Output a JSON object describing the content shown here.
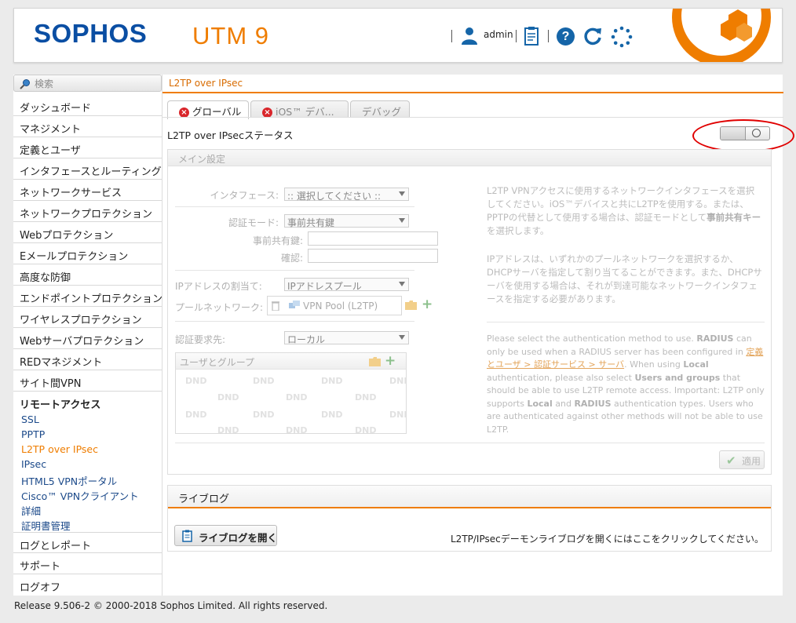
{
  "header": {
    "logo": "SOPHOS",
    "product": "UTM 9",
    "user": "admin",
    "brand_color": "#ef7d00",
    "logo_color": "#0a4ea3"
  },
  "sidebar": {
    "search_placeholder": "検索",
    "items": [
      "ダッシュボード",
      "マネジメント",
      "定義とユーザ",
      "インタフェースとルーティング",
      "ネットワークサービス",
      "ネットワークプロテクション",
      "Webプロテクション",
      "Eメールプロテクション",
      "高度な防御",
      "エンドポイントプロテクション",
      "ワイヤレスプロテクション",
      "Webサーバプロテクション",
      "REDマネジメント",
      "サイト間VPN",
      "リモートアクセス"
    ],
    "subitems": [
      "SSL",
      "PPTP",
      "L2TP over IPsec",
      "IPsec",
      "HTML5 VPNポータル",
      "Cisco™ VPNクライアント",
      "詳細",
      "証明書管理"
    ],
    "bottom_items": [
      "ログとレポート",
      "サポート",
      "ログオフ"
    ]
  },
  "main": {
    "breadcrumb": "L2TP over IPsec",
    "tabs": [
      "グローバル",
      "iOS™ デバ...",
      "デバッグ"
    ],
    "status_label": "L2TP over IPsecステータス",
    "status_enabled": false,
    "panel": {
      "title": "メイン設定",
      "interface_label": "インタフェース:",
      "interface_value": ":: 選択してください ::",
      "auth_mode_label": "認証モード:",
      "auth_mode_value": "事前共有鍵",
      "psk_label": "事前共有鍵:",
      "confirm_label": "確認:",
      "ip_assign_label": "IPアドレスの割当て:",
      "ip_assign_value": "IPアドレスプール",
      "pool_label": "プールネットワーク:",
      "pool_value": "VPN Pool (L2TP)",
      "auth_via_label": "認証要求先:",
      "auth_via_value": "ローカル",
      "users_title": "ユーザとグループ",
      "dnd": "DND",
      "help1": "L2TP VPNアクセスに使用するネットワークインタフェースを選択してください。iOS™デバイスと共にL2TPを使用する。または、PPTPの代替として使用する場合は、認証モードとして",
      "help1_bold": "事前共有キー",
      "help1_end": "を選択します。",
      "help2": "IPアドレスは、いずれかのプールネットワークを選択するか、DHCPサーバを指定して割り当てることができます。また、DHCPサーバを使用する場合は、それが到達可能なネットワークインタフェースを指定する必要があります。",
      "help3_a": "Please select the authentication method to use.",
      "help3_b": "RADIUS",
      "help3_c": "can only be used when a RADIUS server has been configured in",
      "help3_link": "定義とユーザ > 認証サービス > サーバ",
      "help3_d": ". When using",
      "help3_e": "Local",
      "help3_f": "authentication, please also select",
      "help3_g": "Users and groups",
      "help3_h": "that should be able to use L2TP remote access. Important: L2TP only supports",
      "help3_i": "Local",
      "help3_j": "and",
      "help3_k": "RADIUS",
      "help3_l": "authentication types. Users who are authenticated against other methods will not be able to use L2TP.",
      "apply": "適用"
    },
    "live": {
      "title": "ライブログ",
      "button": "ライブログを開く",
      "description": "L2TP/IPsecデーモンライブログを開くにはここをクリックしてください。"
    }
  },
  "footer": "Release 9.506-2  © 2000-2018 Sophos Limited. All rights reserved."
}
